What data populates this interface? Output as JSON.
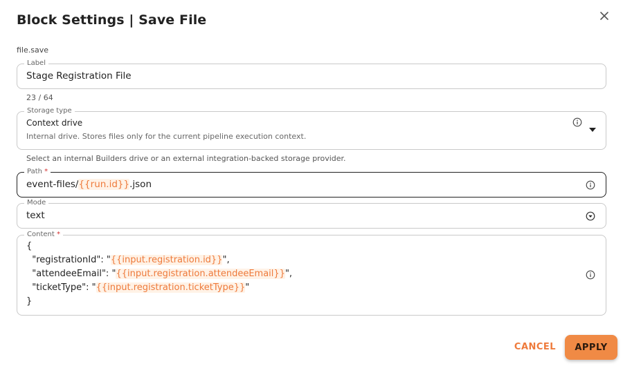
{
  "dialog": {
    "title": "Block Settings | Save File",
    "block_id": "file.save",
    "close_icon": "close-icon"
  },
  "label_field": {
    "legend": "Label",
    "value": "Stage Registration File",
    "counter": "23 / 64"
  },
  "storage_field": {
    "legend": "Storage type",
    "value": "Context drive",
    "description": "Internal drive. Stores files only for the current pipeline execution context.",
    "helper": "Select an internal Builders drive or an external integration-backed storage provider.",
    "info_icon": "info-icon",
    "dropdown_icon": "caret-down-icon"
  },
  "path_field": {
    "legend": "Path",
    "required_mark": "*",
    "prefix": "event-files/",
    "template": "{{run.id}}",
    "suffix": ".json",
    "info_icon": "info-icon"
  },
  "mode_field": {
    "legend": "Mode",
    "value": "text",
    "dropdown_icon": "dropdown-icon"
  },
  "content_field": {
    "legend": "Content",
    "required_mark": "*",
    "lines": {
      "l1": "{",
      "l2_key": "  \"registrationId\": \"",
      "l2_templ": "{{input.registration.id}}",
      "l2_end": "\",",
      "l3_key": "  \"attendeeEmail\": \"",
      "l3_templ": "{{input.registration.attendeeEmail}}",
      "l3_end": "\",",
      "l4_key": "  \"ticketType\": \"",
      "l4_templ": "{{input.registration.ticketType}}",
      "l4_end": "\"",
      "l5": "}"
    },
    "info_icon": "info-icon"
  },
  "actions": {
    "cancel_label": "CANCEL",
    "apply_label": "APPLY"
  },
  "colors": {
    "accent": "#ee7a3b",
    "apply_bg": "#f08a45",
    "required": "#d32f2f"
  }
}
